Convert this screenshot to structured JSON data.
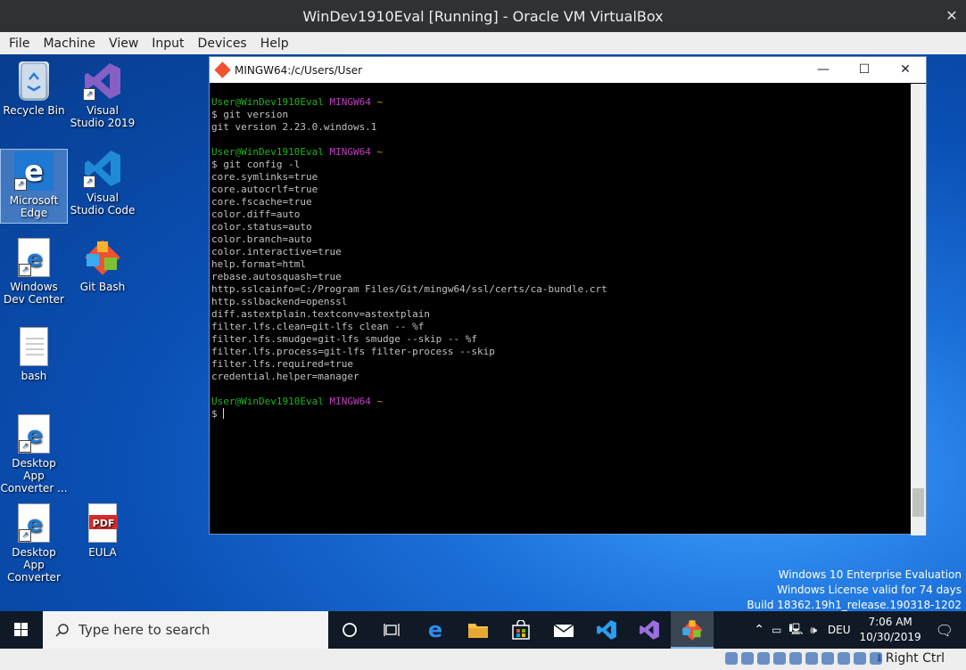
{
  "vbox": {
    "title": "WinDev1910Eval [Running] - Oracle VM VirtualBox",
    "close": "✕",
    "menu": [
      "File",
      "Machine",
      "View",
      "Input",
      "Devices",
      "Help"
    ],
    "host_key": "Right Ctrl"
  },
  "desktop": {
    "icons": [
      {
        "label": "Recycle Bin",
        "icon": "recycle-bin-icon"
      },
      {
        "label": "Visual Studio 2019",
        "icon": "visual-studio-icon"
      },
      {
        "label": "Microsoft Edge",
        "icon": "edge-icon"
      },
      {
        "label": "Visual Studio Code",
        "icon": "vscode-icon"
      },
      {
        "label": "Windows Dev Center",
        "icon": "edge-doc-icon"
      },
      {
        "label": "Git Bash",
        "icon": "git-bash-icon"
      },
      {
        "label": "bash",
        "icon": "text-file-icon"
      },
      {
        "label": "Desktop App Converter ...",
        "icon": "edge-doc-icon"
      },
      {
        "label": "Desktop App Converter",
        "icon": "edge-doc-icon"
      },
      {
        "label": "EULA",
        "icon": "pdf-icon"
      }
    ],
    "pdf_badge": "PDF"
  },
  "terminal": {
    "title": "MINGW64:/c/Users/User",
    "controls": {
      "minimize": "—",
      "maximize": "☐",
      "close": "✕"
    },
    "prompt": {
      "user": "User@WinDev1910Eval",
      "host": "MINGW64",
      "path": "~",
      "dollar": "$"
    },
    "commands": [
      {
        "cmd": "git version",
        "output": [
          "git version 2.23.0.windows.1"
        ]
      },
      {
        "cmd": "git config -l",
        "output": [
          "core.symlinks=true",
          "core.autocrlf=true",
          "core.fscache=true",
          "color.diff=auto",
          "color.status=auto",
          "color.branch=auto",
          "color.interactive=true",
          "help.format=html",
          "rebase.autosquash=true",
          "http.sslcainfo=C:/Program Files/Git/mingw64/ssl/certs/ca-bundle.crt",
          "http.sslbackend=openssl",
          "diff.astextplain.textconv=astextplain",
          "filter.lfs.clean=git-lfs clean -- %f",
          "filter.lfs.smudge=git-lfs smudge --skip -- %f",
          "filter.lfs.process=git-lfs filter-process --skip",
          "filter.lfs.required=true",
          "credential.helper=manager"
        ]
      }
    ]
  },
  "watermark": {
    "line1": "Windows 10 Enterprise Evaluation",
    "line2": "Windows License valid for 74 days",
    "line3": "Build 18362.19h1_release.190318-1202"
  },
  "taskbar": {
    "search_placeholder": "Type here to search",
    "tray": {
      "language": "DEU",
      "time": "7:06 AM",
      "date": "10/30/2019"
    }
  },
  "colors": {
    "prompt_user": "#1fb31f",
    "prompt_host": "#c13ec1",
    "prompt_path": "#c0a020",
    "taskbar": "#101a26"
  }
}
